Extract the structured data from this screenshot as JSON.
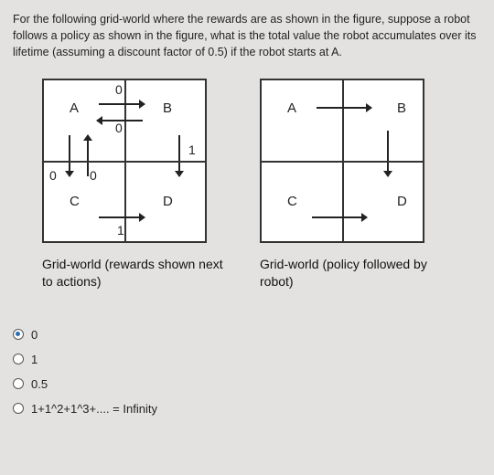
{
  "question": "For the following grid-world where the rewards are as shown in the figure, suppose a robot follows a policy as shown in the figure, what is the total value the robot accumulates over its lifetime (assuming a discount factor of 0.5) if the robot starts at A.",
  "left": {
    "labels": {
      "A": "A",
      "B": "B",
      "C": "C",
      "D": "D"
    },
    "edges": {
      "ab_top": "0",
      "ab_bottom": "0",
      "bd": "1",
      "ac_left": "0",
      "ac_right": "0",
      "cd": "1"
    },
    "caption": "Grid-world (rewards shown next to actions)"
  },
  "right": {
    "labels": {
      "A": "A",
      "B": "B",
      "C": "C",
      "D": "D"
    },
    "caption": "Grid-world (policy followed by robot)"
  },
  "options": [
    {
      "label": "0",
      "selected": true
    },
    {
      "label": "1",
      "selected": false
    },
    {
      "label": "0.5",
      "selected": false
    },
    {
      "label": "1+1^2+1^3+.... = Infinity",
      "selected": false
    }
  ]
}
